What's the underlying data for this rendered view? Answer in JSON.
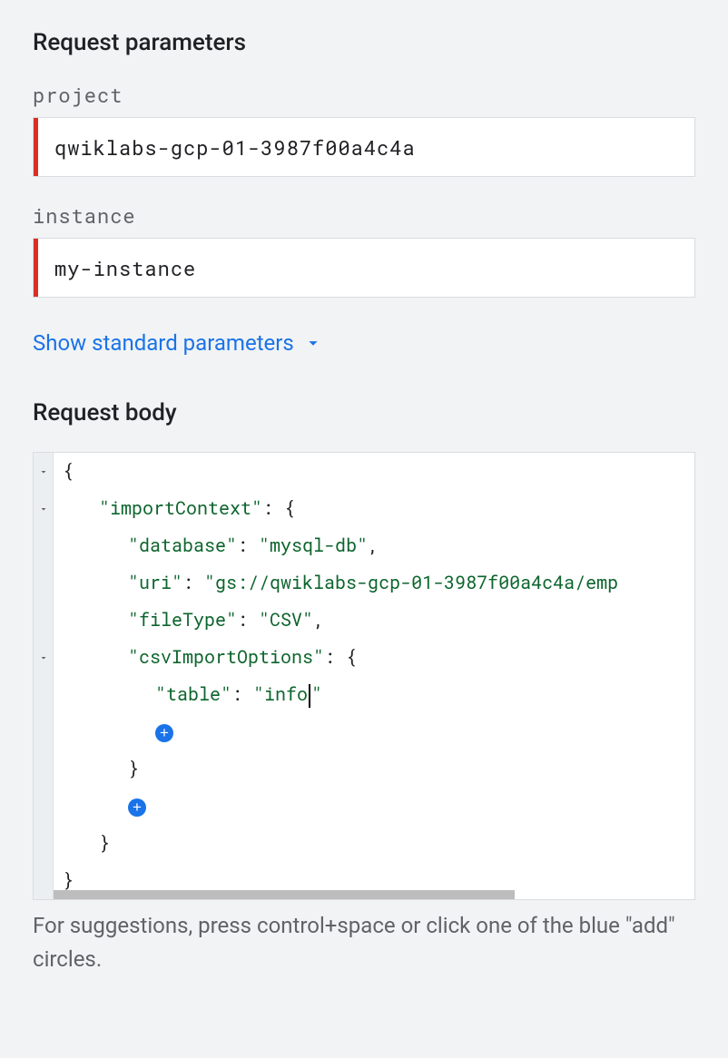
{
  "headings": {
    "request_parameters": "Request parameters",
    "request_body": "Request body"
  },
  "fields": {
    "project": {
      "label": "project",
      "value": "qwiklabs-gcp-01-3987f00a4c4a"
    },
    "instance": {
      "label": "instance",
      "value": "my-instance"
    }
  },
  "toggle": {
    "show_standard_parameters": "Show standard parameters"
  },
  "body": {
    "keys": {
      "importContext": "\"importContext\"",
      "database": "\"database\"",
      "uri": "\"uri\"",
      "fileType": "\"fileType\"",
      "csvImportOptions": "\"csvImportOptions\"",
      "table": "\"table\""
    },
    "vals": {
      "database": "\"mysql-db\"",
      "uri": "\"gs://qwiklabs-gcp-01-3987f00a4c4a/emp",
      "fileType": "\"CSV\"",
      "table_pre": "\"info",
      "table_post": "\""
    },
    "raw": {
      "importContext": {
        "database": "mysql-db",
        "uri": "gs://qwiklabs-gcp-01-3987f00a4c4a/emp",
        "fileType": "CSV",
        "csvImportOptions": {
          "table": "info"
        }
      }
    }
  },
  "hint": "For suggestions, press control+space or click one of the blue \"add\" circles."
}
